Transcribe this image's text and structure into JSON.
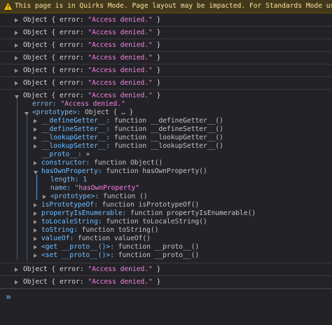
{
  "warning": {
    "text": "This page is in Quirks Mode. Page layout may be impacted. For Standards Mode us",
    "icon": "warning-icon",
    "color": "#fce2a1"
  },
  "collapsed_object": {
    "prefix": "Object { ",
    "key": "error:",
    "value": "\"Access denied.\"",
    "suffix": " }"
  },
  "expanded": {
    "header_prefix": "Object { ",
    "header_key": "error:",
    "header_value": "\"Access denied.\"",
    "header_suffix": " }",
    "error_key": "error:",
    "error_value": "\"Access denied.\"",
    "prototype_key": "<prototype>:",
    "prototype_value": "Object { … }",
    "members": [
      {
        "key": "__defineGetter__:",
        "value": "function __defineGetter__()"
      },
      {
        "key": "__defineSetter__:",
        "value": "function __defineSetter__()"
      },
      {
        "key": "__lookupGetter__:",
        "value": "function __lookupGetter__()"
      },
      {
        "key": "__lookupSetter__:",
        "value": "function __lookupSetter__()"
      },
      {
        "key": "__proto__:",
        "value": "»"
      },
      {
        "key": "constructor:",
        "value": "function Object()"
      },
      {
        "key": "hasOwnProperty:",
        "value": "function hasOwnProperty()"
      }
    ],
    "hasOwn_length_key": "length:",
    "hasOwn_length_value": "1",
    "hasOwn_name_key": "name:",
    "hasOwn_name_value": "\"hasOwnProperty\"",
    "hasOwn_proto_key": "<prototype>:",
    "hasOwn_proto_value": "function ()",
    "members2": [
      {
        "key": "isPrototypeOf:",
        "value": "function isPrototypeOf()"
      },
      {
        "key": "propertyIsEnumerable:",
        "value": "function propertyIsEnumerable()"
      },
      {
        "key": "toLocaleString:",
        "value": "function toLocaleString()"
      },
      {
        "key": "toString:",
        "value": "function toString()"
      },
      {
        "key": "valueOf:",
        "value": "function valueOf()"
      },
      {
        "key": "<get __proto__()>:",
        "value": "function __proto__()"
      },
      {
        "key": "<set __proto__()>:",
        "value": "function __proto__()"
      }
    ]
  },
  "prompt": {
    "symbol": "»"
  }
}
